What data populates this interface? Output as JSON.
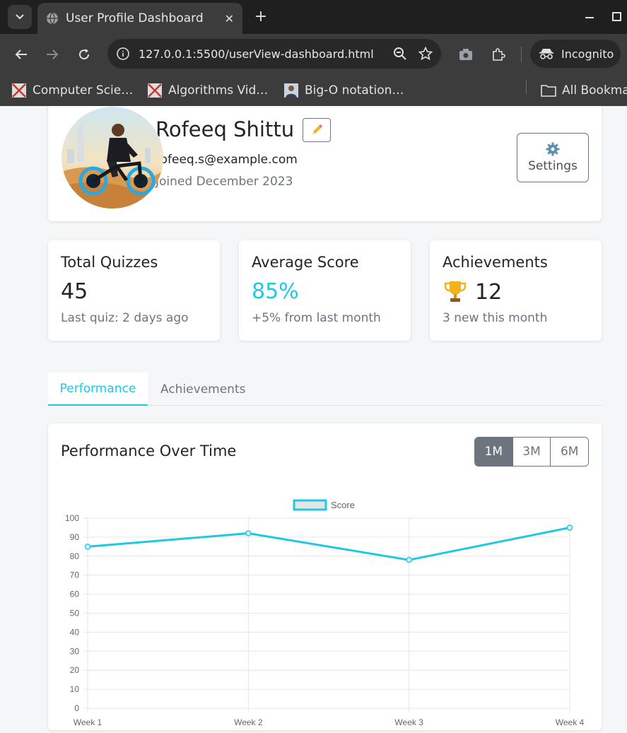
{
  "browser": {
    "tab_title": "User Profile Dashboard",
    "url": "127.0.0.1:5500/userView-dashboard.html",
    "incognito_label": "Incognito",
    "bookmarks": [
      "Computer Scie…",
      "Algorithms Vid…",
      "Big-O notation…"
    ],
    "all_bookmarks_label": "All Bookma"
  },
  "profile": {
    "name": "Rofeeq Shittu",
    "email": "rofeeq.s@example.com",
    "joined": "Joined December 2023",
    "settings_label": "Settings"
  },
  "stats": [
    {
      "title": "Total Quizzes",
      "value": "45",
      "sub": "Last quiz: 2 days ago"
    },
    {
      "title": "Average Score",
      "value": "85%",
      "sub": "+5% from last month"
    },
    {
      "title": "Achievements",
      "value": "12",
      "sub": "3 new this month",
      "icon": "trophy-icon"
    }
  ],
  "tabs": [
    "Performance",
    "Achievements"
  ],
  "performance": {
    "title": "Performance Over Time",
    "ranges": [
      "1M",
      "3M",
      "6M"
    ],
    "active_range": "1M"
  },
  "colors": {
    "accent": "#1fc8e3",
    "muted": "#6c757d",
    "series": "#1fc8e3"
  },
  "chart_data": {
    "type": "line",
    "categories": [
      "Week 1",
      "Week 2",
      "Week 3",
      "Week 4"
    ],
    "series": [
      {
        "name": "Score",
        "values": [
          85,
          92,
          78,
          95
        ]
      }
    ],
    "ylim": [
      0,
      100
    ],
    "yticks": [
      0,
      10,
      20,
      30,
      40,
      50,
      60,
      70,
      80,
      90,
      100
    ],
    "grid": true,
    "legend": "top-center"
  }
}
